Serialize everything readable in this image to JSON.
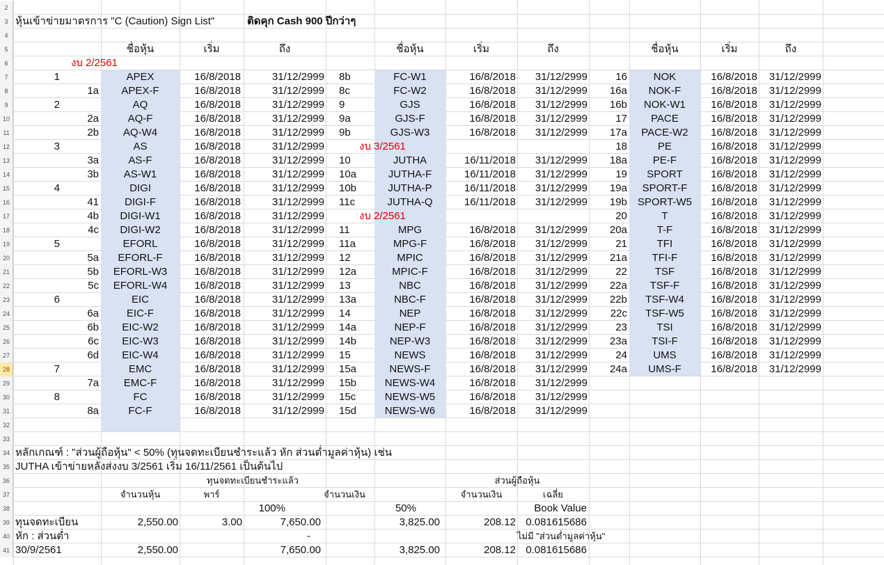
{
  "row_start": 2,
  "row_end": 41,
  "selected_row": 28,
  "colors": {
    "ticker_fill": "#d9e2f3",
    "section_red": "#e00000",
    "row_header_selected": "#fde9a8"
  },
  "title": {
    "main": "หุ้นเข้าข่ายมาตรการ \"C (Caution) Sign List\"",
    "bold": "ติดคุก Cash 900 ปีกว่าๆ"
  },
  "headers": {
    "name": "ชื่อหุ้น",
    "start": "เริ่ม",
    "end": "ถึง"
  },
  "sections": {
    "s1": "งบ 2/2561",
    "s2": "งบ 3/2561",
    "s3": "งบ 2/2561"
  },
  "block1": [
    [
      "1",
      "",
      "APEX",
      "16/8/2018",
      "31/12/2999"
    ],
    [
      "",
      "1a",
      "APEX-F",
      "16/8/2018",
      "31/12/2999"
    ],
    [
      "2",
      "",
      "AQ",
      "16/8/2018",
      "31/12/2999"
    ],
    [
      "",
      "2a",
      "AQ-F",
      "16/8/2018",
      "31/12/2999"
    ],
    [
      "",
      "2b",
      "AQ-W4",
      "16/8/2018",
      "31/12/2999"
    ],
    [
      "3",
      "",
      "AS",
      "16/8/2018",
      "31/12/2999"
    ],
    [
      "",
      "3a",
      "AS-F",
      "16/8/2018",
      "31/12/2999"
    ],
    [
      "",
      "3b",
      "AS-W1",
      "16/8/2018",
      "31/12/2999"
    ],
    [
      "4",
      "",
      "DIGI",
      "16/8/2018",
      "31/12/2999"
    ],
    [
      "",
      "41",
      "DIGI-F",
      "16/8/2018",
      "31/12/2999"
    ],
    [
      "",
      "4b",
      "DIGI-W1",
      "16/8/2018",
      "31/12/2999"
    ],
    [
      "",
      "4c",
      "DIGI-W2",
      "16/8/2018",
      "31/12/2999"
    ],
    [
      "5",
      "",
      "EFORL",
      "16/8/2018",
      "31/12/2999"
    ],
    [
      "",
      "5a",
      "EFORL-F",
      "16/8/2018",
      "31/12/2999"
    ],
    [
      "",
      "5b",
      "EFORL-W3",
      "16/8/2018",
      "31/12/2999"
    ],
    [
      "",
      "5c",
      "EFORL-W4",
      "16/8/2018",
      "31/12/2999"
    ],
    [
      "6",
      "",
      "EIC",
      "16/8/2018",
      "31/12/2999"
    ],
    [
      "",
      "6a",
      "EIC-F",
      "16/8/2018",
      "31/12/2999"
    ],
    [
      "",
      "6b",
      "EIC-W2",
      "16/8/2018",
      "31/12/2999"
    ],
    [
      "",
      "6c",
      "EIC-W3",
      "16/8/2018",
      "31/12/2999"
    ],
    [
      "",
      "6d",
      "EIC-W4",
      "16/8/2018",
      "31/12/2999"
    ],
    [
      "7",
      "",
      "EMC",
      "16/8/2018",
      "31/12/2999"
    ],
    [
      "",
      "7a",
      "EMC-F",
      "16/8/2018",
      "31/12/2999"
    ],
    [
      "8",
      "",
      "FC",
      "16/8/2018",
      "31/12/2999"
    ],
    [
      "",
      "8a",
      "FC-F",
      "16/8/2018",
      "31/12/2999"
    ]
  ],
  "block2": [
    [
      "8b",
      "FC-W1",
      "16/8/2018",
      "31/12/2999"
    ],
    [
      "8c",
      "FC-W2",
      "16/8/2018",
      "31/12/2999"
    ],
    [
      "9",
      "GJS",
      "16/8/2018",
      "31/12/2999"
    ],
    [
      "9a",
      "GJS-F",
      "16/8/2018",
      "31/12/2999"
    ],
    [
      "9b",
      "GJS-W3",
      "16/8/2018",
      "31/12/2999"
    ],
    null,
    [
      "10",
      "JUTHA",
      "16/11/2018",
      "31/12/2999"
    ],
    [
      "10a",
      "JUTHA-F",
      "16/11/2018",
      "31/12/2999"
    ],
    [
      "10b",
      "JUTHA-P",
      "16/11/2018",
      "31/12/2999"
    ],
    [
      "11c",
      "JUTHA-Q",
      "16/11/2018",
      "31/12/2999"
    ],
    null,
    [
      "11",
      "MPG",
      "16/8/2018",
      "31/12/2999"
    ],
    [
      "11a",
      "MPG-F",
      "16/8/2018",
      "31/12/2999"
    ],
    [
      "12",
      "MPIC",
      "16/8/2018",
      "31/12/2999"
    ],
    [
      "12a",
      "MPIC-F",
      "16/8/2018",
      "31/12/2999"
    ],
    [
      "13",
      "NBC",
      "16/8/2018",
      "31/12/2999"
    ],
    [
      "13a",
      "NBC-F",
      "16/8/2018",
      "31/12/2999"
    ],
    [
      "14",
      "NEP",
      "16/8/2018",
      "31/12/2999"
    ],
    [
      "14a",
      "NEP-F",
      "16/8/2018",
      "31/12/2999"
    ],
    [
      "14b",
      "NEP-W3",
      "16/8/2018",
      "31/12/2999"
    ],
    [
      "15",
      "NEWS",
      "16/8/2018",
      "31/12/2999"
    ],
    [
      "15a",
      "NEWS-F",
      "16/8/2018",
      "31/12/2999"
    ],
    [
      "15b",
      "NEWS-W4",
      "16/8/2018",
      "31/12/2999"
    ],
    [
      "15c",
      "NEWS-W5",
      "16/8/2018",
      "31/12/2999"
    ],
    [
      "15d",
      "NEWS-W6",
      "16/8/2018",
      "31/12/2999"
    ]
  ],
  "block3": [
    [
      "16",
      "NOK",
      "16/8/2018",
      "31/12/2999"
    ],
    [
      "16a",
      "NOK-F",
      "16/8/2018",
      "31/12/2999"
    ],
    [
      "16b",
      "NOK-W1",
      "16/8/2018",
      "31/12/2999"
    ],
    [
      "17",
      "PACE",
      "16/8/2018",
      "31/12/2999"
    ],
    [
      "17a",
      "PACE-W2",
      "16/8/2018",
      "31/12/2999"
    ],
    [
      "18",
      "PE",
      "16/8/2018",
      "31/12/2999"
    ],
    [
      "18a",
      "PE-F",
      "16/8/2018",
      "31/12/2999"
    ],
    [
      "19",
      "SPORT",
      "16/8/2018",
      "31/12/2999"
    ],
    [
      "19a",
      "SPORT-F",
      "16/8/2018",
      "31/12/2999"
    ],
    [
      "19b",
      "SPORT-W5",
      "16/8/2018",
      "31/12/2999"
    ],
    [
      "20",
      "T",
      "16/8/2018",
      "31/12/2999"
    ],
    [
      "20a",
      "T-F",
      "16/8/2018",
      "31/12/2999"
    ],
    [
      "21",
      "TFI",
      "16/8/2018",
      "31/12/2999"
    ],
    [
      "21a",
      "TFI-F",
      "16/8/2018",
      "31/12/2999"
    ],
    [
      "22",
      "TSF",
      "16/8/2018",
      "31/12/2999"
    ],
    [
      "22a",
      "TSF-F",
      "16/8/2018",
      "31/12/2999"
    ],
    [
      "22b",
      "TSF-W4",
      "16/8/2018",
      "31/12/2999"
    ],
    [
      "22c",
      "TSF-W5",
      "16/8/2018",
      "31/12/2999"
    ],
    [
      "23",
      "TSI",
      "16/8/2018",
      "31/12/2999"
    ],
    [
      "23a",
      "TSI-F",
      "16/8/2018",
      "31/12/2999"
    ],
    [
      "24",
      "UMS",
      "16/8/2018",
      "31/12/2999"
    ],
    [
      "24a",
      "UMS-F",
      "16/8/2018",
      "31/12/2999"
    ]
  ],
  "notes": {
    "line1": "หลักเกณฑ์ :  \"ส่วนผู้ถือหุ้น\" < 50% (ทุนจดทะเบียนชำระแล้ว หัก ส่วนต่ำมูลค่าหุ้น)  เช่น",
    "line2": "JUTHA เข้าข่ายหลังส่งงบ 3/2561 เริ่ม 16/11/2561 เป็นต้นไป"
  },
  "calc": {
    "h_paid": "ทุนจดทะเบียนชำระแล้ว",
    "h_equity": "ส่วนผู้ถือหุ้น",
    "h_shares": "จำนวนหุ้น",
    "h_par": "พาร์",
    "h_amount": "จำนวนเงิน",
    "h_amount2": "จำนวนเงิน",
    "h_avg": "เฉลี่ย",
    "pct100": "100%",
    "pct50": "50%",
    "bv": "Book Value",
    "r39_label": "ทุนจดทะเบียน",
    "r39_shares": "2,550.00",
    "r39_par": "3.00",
    "r39_amt": "7,650.00",
    "r39_half": "3,825.00",
    "r39_eq": "208.12",
    "r39_avg": "0.081615686",
    "r40_label": "หัก : ส่วนต่ำ",
    "r40_amt": "-",
    "r40_note": "ไม่มี \"ส่วนต่ำมูลค่าหุ้น\"",
    "r41_label": "30/9/2561",
    "r41_shares": "2,550.00",
    "r41_amt": "7,650.00",
    "r41_half": "3,825.00",
    "r41_eq": "208.12",
    "r41_avg": "0.081615686"
  }
}
